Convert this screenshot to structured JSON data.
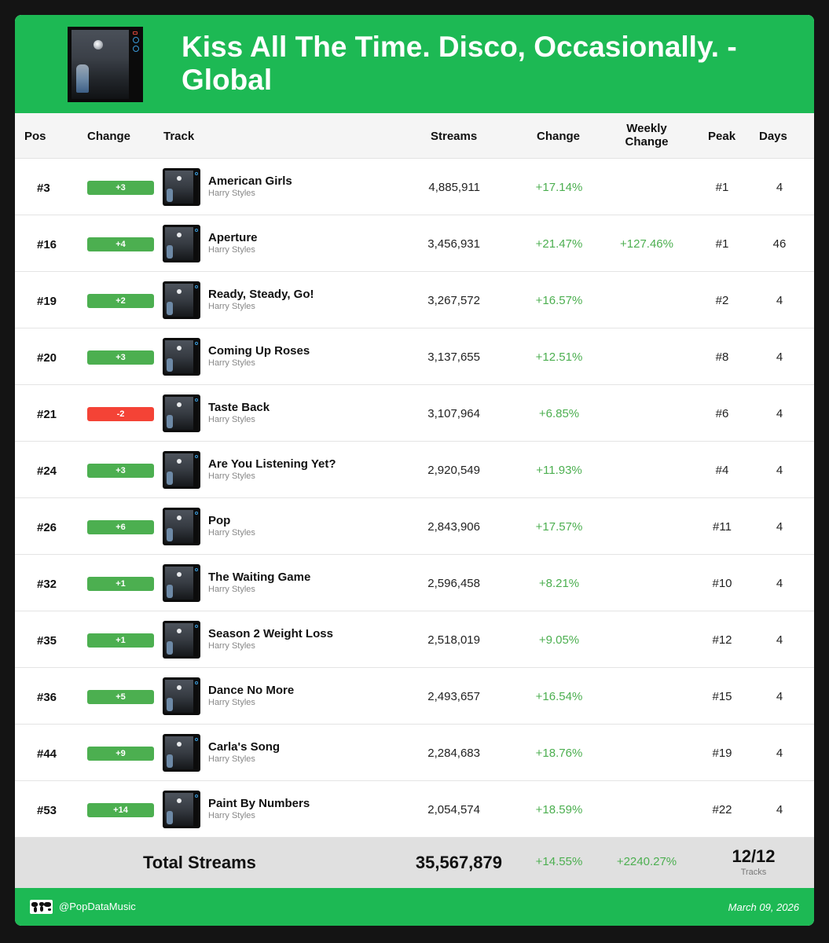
{
  "header": {
    "title": "Kiss All The Time. Disco, Occasionally. - Global"
  },
  "columns": {
    "pos": "Pos",
    "change": "Change",
    "track": "Track",
    "streams": "Streams",
    "change2": "Change",
    "weekly_line1": "Weekly",
    "weekly_line2": "Change",
    "peak": "Peak",
    "days": "Days"
  },
  "colors": {
    "brand": "#1db954",
    "positive": "#4caf50",
    "negative": "#f44336"
  },
  "rows": [
    {
      "pos": "#3",
      "change": "+3",
      "direction": "up",
      "track": "American Girls",
      "artist": "Harry Styles",
      "streams": "4,885,911",
      "pct": "+17.14%",
      "weekly": "",
      "peak": "#1",
      "days": "4"
    },
    {
      "pos": "#16",
      "change": "+4",
      "direction": "up",
      "track": "Aperture",
      "artist": "Harry Styles",
      "streams": "3,456,931",
      "pct": "+21.47%",
      "weekly": "+127.46%",
      "peak": "#1",
      "days": "46"
    },
    {
      "pos": "#19",
      "change": "+2",
      "direction": "up",
      "track": "Ready, Steady, Go!",
      "artist": "Harry Styles",
      "streams": "3,267,572",
      "pct": "+16.57%",
      "weekly": "",
      "peak": "#2",
      "days": "4"
    },
    {
      "pos": "#20",
      "change": "+3",
      "direction": "up",
      "track": "Coming Up Roses",
      "artist": "Harry Styles",
      "streams": "3,137,655",
      "pct": "+12.51%",
      "weekly": "",
      "peak": "#8",
      "days": "4"
    },
    {
      "pos": "#21",
      "change": "-2",
      "direction": "down",
      "track": "Taste Back",
      "artist": "Harry Styles",
      "streams": "3,107,964",
      "pct": "+6.85%",
      "weekly": "",
      "peak": "#6",
      "days": "4"
    },
    {
      "pos": "#24",
      "change": "+3",
      "direction": "up",
      "track": "Are You Listening Yet?",
      "artist": "Harry Styles",
      "streams": "2,920,549",
      "pct": "+11.93%",
      "weekly": "",
      "peak": "#4",
      "days": "4"
    },
    {
      "pos": "#26",
      "change": "+6",
      "direction": "up",
      "track": "Pop",
      "artist": "Harry Styles",
      "streams": "2,843,906",
      "pct": "+17.57%",
      "weekly": "",
      "peak": "#11",
      "days": "4"
    },
    {
      "pos": "#32",
      "change": "+1",
      "direction": "up",
      "track": "The Waiting Game",
      "artist": "Harry Styles",
      "streams": "2,596,458",
      "pct": "+8.21%",
      "weekly": "",
      "peak": "#10",
      "days": "4"
    },
    {
      "pos": "#35",
      "change": "+1",
      "direction": "up",
      "track": "Season 2 Weight Loss",
      "artist": "Harry Styles",
      "streams": "2,518,019",
      "pct": "+9.05%",
      "weekly": "",
      "peak": "#12",
      "days": "4"
    },
    {
      "pos": "#36",
      "change": "+5",
      "direction": "up",
      "track": "Dance No More",
      "artist": "Harry Styles",
      "streams": "2,493,657",
      "pct": "+16.54%",
      "weekly": "",
      "peak": "#15",
      "days": "4"
    },
    {
      "pos": "#44",
      "change": "+9",
      "direction": "up",
      "track": "Carla's Song",
      "artist": "Harry Styles",
      "streams": "2,284,683",
      "pct": "+18.76%",
      "weekly": "",
      "peak": "#19",
      "days": "4"
    },
    {
      "pos": "#53",
      "change": "+14",
      "direction": "up",
      "track": "Paint By Numbers",
      "artist": "Harry Styles",
      "streams": "2,054,574",
      "pct": "+18.59%",
      "weekly": "",
      "peak": "#22",
      "days": "4"
    }
  ],
  "total": {
    "label": "Total Streams",
    "streams": "35,567,879",
    "pct": "+14.55%",
    "weekly": "+2240.27%",
    "count": "12/12",
    "count_label": "Tracks"
  },
  "footer": {
    "handle": "@PopDataMusic",
    "date": "March 09, 2026",
    "icon": "world-map-icon"
  }
}
